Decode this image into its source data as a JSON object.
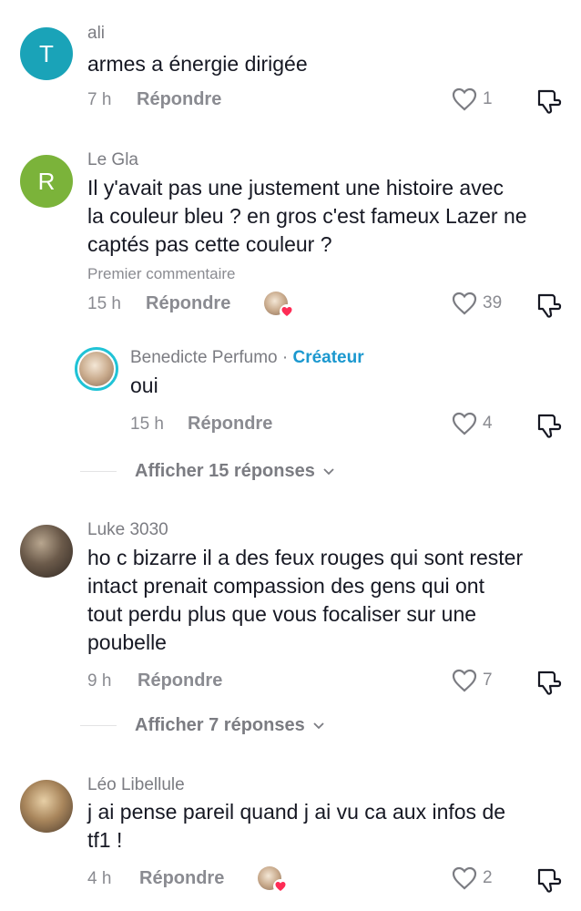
{
  "comments": [
    {
      "avatar_letter": "T",
      "username": "ali",
      "text": "armes a énergie dirigée",
      "time": "7 h",
      "reply_label": "Répondre",
      "likes": "1"
    },
    {
      "avatar_letter": "R",
      "username": "Le Gla",
      "text_lines": [
        "Il y'avait pas une justement une histoire avec",
        "la couleur bleu ? en gros c'est fameux Lazer ne",
        "captés pas cette couleur ?"
      ],
      "pinned_label": "Premier commentaire",
      "time": "15 h",
      "reply_label": "Répondre",
      "likes": "39",
      "reply": {
        "username": "Benedicte Perfumo",
        "separator": " · ",
        "creator_label": "Créateur",
        "text": "oui",
        "time": "15 h",
        "reply_label": "Répondre",
        "likes": "4"
      },
      "view_replies": "Afficher 15 réponses"
    },
    {
      "username": "Luke 3030",
      "text_lines": [
        "ho c bizarre il a des feux rouges qui sont rester",
        "intact prenait compassion des gens qui ont",
        "tout perdu plus que vous focaliser sur une",
        "poubelle"
      ],
      "time": "9 h",
      "reply_label": "Répondre",
      "likes": "7",
      "view_replies": "Afficher 7 réponses"
    },
    {
      "username": "Léo Libellule",
      "text_lines": [
        "j ai pense pareil quand j ai vu ca aux infos de",
        "tf1 !"
      ],
      "time": "4 h",
      "reply_label": "Répondre",
      "likes": "2"
    }
  ],
  "colors": {
    "accent_teal": "#1aa3b8",
    "accent_green": "#7bb33a",
    "creator_blue": "#1b98cf",
    "heart_red": "#fe2c55"
  }
}
